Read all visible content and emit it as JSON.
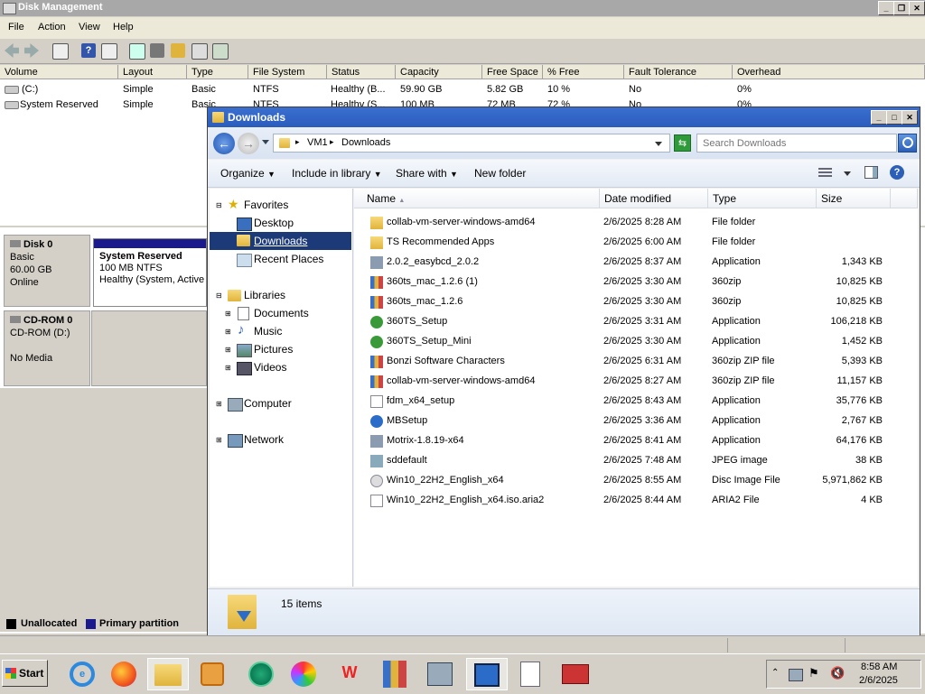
{
  "disk_management": {
    "title": "Disk Management",
    "menu": [
      "File",
      "Action",
      "View",
      "Help"
    ],
    "columns": [
      "Volume",
      "Layout",
      "Type",
      "File System",
      "Status",
      "Capacity",
      "Free Space",
      "% Free",
      "Fault Tolerance",
      "Overhead"
    ],
    "volumes": [
      {
        "volume": "(C:)",
        "layout": "Simple",
        "type": "Basic",
        "fs": "NTFS",
        "status": "Healthy (B...",
        "capacity": "59.90 GB",
        "free": "5.82 GB",
        "pct": "10 %",
        "fault": "No",
        "overhead": "0%"
      },
      {
        "volume": "System Reserved",
        "layout": "Simple",
        "type": "Basic",
        "fs": "NTFS",
        "status": "Healthy (S...",
        "capacity": "100 MB",
        "free": "72 MB",
        "pct": "72 %",
        "fault": "No",
        "overhead": "0%"
      }
    ],
    "disk0": {
      "name": "Disk 0",
      "type": "Basic",
      "size": "60.00 GB",
      "status": "Online"
    },
    "partition": {
      "name": "System Reserved",
      "size": "100 MB NTFS",
      "status": "Healthy (System, Active"
    },
    "cdrom": {
      "name": "CD-ROM 0",
      "drive": "CD-ROM (D:)",
      "media": "No Media"
    },
    "legend": {
      "unallocated": "Unallocated",
      "primary": "Primary partition"
    }
  },
  "explorer": {
    "title": "Downloads",
    "breadcrumb": [
      "VM1",
      "Downloads"
    ],
    "search_placeholder": "Search Downloads",
    "commands": {
      "organize": "Organize",
      "include": "Include in library",
      "share": "Share with",
      "new_folder": "New folder"
    },
    "nav": {
      "favorites": "Favorites",
      "desktop": "Desktop",
      "downloads": "Downloads",
      "recent": "Recent Places",
      "libraries": "Libraries",
      "documents": "Documents",
      "music": "Music",
      "pictures": "Pictures",
      "videos": "Videos",
      "computer": "Computer",
      "network": "Network"
    },
    "columns": {
      "name": "Name",
      "date": "Date modified",
      "type": "Type",
      "size": "Size"
    },
    "files": [
      {
        "name": "collab-vm-server-windows-amd64",
        "date": "2/6/2025 8:28 AM",
        "type": "File folder",
        "size": "",
        "icon": "folder-icon"
      },
      {
        "name": "TS Recommended Apps",
        "date": "2/6/2025 6:00 AM",
        "type": "File folder",
        "size": "",
        "icon": "folder-icon"
      },
      {
        "name": "2.0.2_easybcd_2.0.2",
        "date": "2/6/2025 8:37 AM",
        "type": "Application",
        "size": "1,343 KB",
        "icon": "app-icon"
      },
      {
        "name": "360ts_mac_1.2.6 (1)",
        "date": "2/6/2025 3:30 AM",
        "type": "360zip",
        "size": "10,825 KB",
        "icon": "zip-icon"
      },
      {
        "name": "360ts_mac_1.2.6",
        "date": "2/6/2025 3:30 AM",
        "type": "360zip",
        "size": "10,825 KB",
        "icon": "zip-icon"
      },
      {
        "name": "360TS_Setup",
        "date": "2/6/2025 3:31 AM",
        "type": "Application",
        "size": "106,218 KB",
        "icon": "setup-icon"
      },
      {
        "name": "360TS_Setup_Mini",
        "date": "2/6/2025 3:30 AM",
        "type": "Application",
        "size": "1,452 KB",
        "icon": "setup-icon"
      },
      {
        "name": "Bonzi Software Characters",
        "date": "2/6/2025 6:31 AM",
        "type": "360zip ZIP file",
        "size": "5,393 KB",
        "icon": "zip-icon"
      },
      {
        "name": "collab-vm-server-windows-amd64",
        "date": "2/6/2025 8:27 AM",
        "type": "360zip ZIP file",
        "size": "11,157 KB",
        "icon": "zip-icon"
      },
      {
        "name": "fdm_x64_setup",
        "date": "2/6/2025 8:43 AM",
        "type": "Application",
        "size": "35,776 KB",
        "icon": "download-icon"
      },
      {
        "name": "MBSetup",
        "date": "2/6/2025 3:36 AM",
        "type": "Application",
        "size": "2,767 KB",
        "icon": "shield-icon"
      },
      {
        "name": "Motrix-1.8.19-x64",
        "date": "2/6/2025 8:41 AM",
        "type": "Application",
        "size": "64,176 KB",
        "icon": "app-icon"
      },
      {
        "name": "sddefault",
        "date": "2/6/2025 7:48 AM",
        "type": "JPEG image",
        "size": "38 KB",
        "icon": "image-icon"
      },
      {
        "name": "Win10_22H2_English_x64",
        "date": "2/6/2025 8:55 AM",
        "type": "Disc Image File",
        "size": "5,971,862 KB",
        "icon": "disc-icon"
      },
      {
        "name": "Win10_22H2_English_x64.iso.aria2",
        "date": "2/6/2025 8:44 AM",
        "type": "ARIA2 File",
        "size": "4 KB",
        "icon": "file-icon"
      }
    ],
    "item_count": "15 items"
  },
  "taskbar": {
    "start": "Start",
    "time": "8:58 AM",
    "date": "2/6/2025"
  }
}
